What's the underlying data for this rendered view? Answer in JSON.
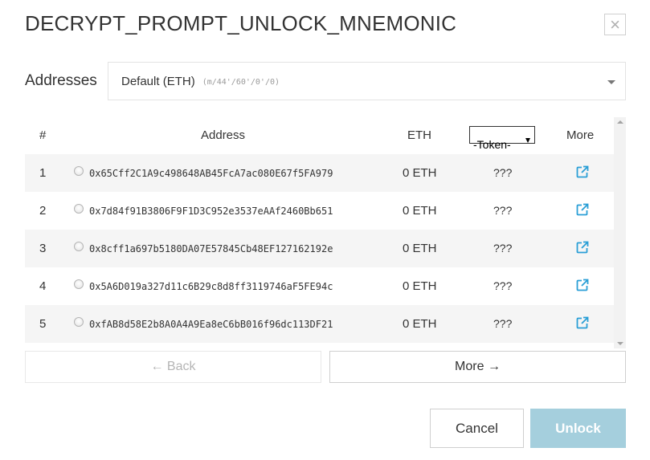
{
  "modal": {
    "title": "DECRYPT_PROMPT_UNLOCK_MNEMONIC",
    "close_glyph": "×"
  },
  "path": {
    "label": "Addresses",
    "selected_name": "Default (ETH)",
    "selected_path": "(m/44'/60'/0'/0)"
  },
  "table": {
    "headers": {
      "num": "#",
      "address": "Address",
      "eth": "ETH",
      "token": "-Token-",
      "more": "More"
    },
    "rows": [
      {
        "num": "1",
        "address": "0x65Cff2C1A9c498648AB45FcA7ac080E67f5FA979",
        "eth": "0 ETH",
        "token": "???"
      },
      {
        "num": "2",
        "address": "0x7d84f91B3806F9F1D3C952e3537eAAf2460Bb651",
        "eth": "0 ETH",
        "token": "???"
      },
      {
        "num": "3",
        "address": "0x8cff1a697b5180DA07E57845Cb48EF127162192e",
        "eth": "0 ETH",
        "token": "???"
      },
      {
        "num": "4",
        "address": "0x5A6D019a327d11c6B29c8d8ff3119746aF5FE94c",
        "eth": "0 ETH",
        "token": "???"
      },
      {
        "num": "5",
        "address": "0xfAB8d58E2b8A0A4A9Ea8eC6bB016f96dc113DF21",
        "eth": "0 ETH",
        "token": "???"
      }
    ],
    "row_icon": "external-link-icon"
  },
  "pagination": {
    "back_label": "← Back",
    "more_label": "More →"
  },
  "footer": {
    "cancel_label": "Cancel",
    "unlock_label": "Unlock"
  },
  "colors": {
    "link_icon": "#2a9fd6",
    "unlock_disabled_bg": "#a5cfdd",
    "row_stripe": "#f5f5f5"
  }
}
